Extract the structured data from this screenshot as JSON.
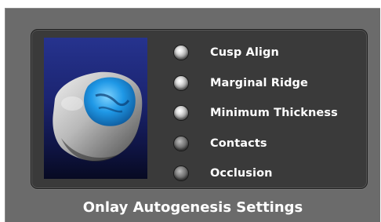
{
  "options": [
    {
      "label": "Cusp Align",
      "state": "on"
    },
    {
      "label": "Marginal Ridge",
      "state": "on"
    },
    {
      "label": "Minimum Thickness",
      "state": "on"
    },
    {
      "label": "Contacts",
      "state": "off"
    },
    {
      "label": "Occlusion",
      "state": "off"
    }
  ],
  "caption": "Onlay Autogenesis Settings",
  "colors": {
    "window_bg": "#6b6b6b",
    "panel_bg": "#3a3a3a",
    "preview_bg": "#1b2470",
    "restoration": "#1e8fe0",
    "text": "#ffffff"
  }
}
